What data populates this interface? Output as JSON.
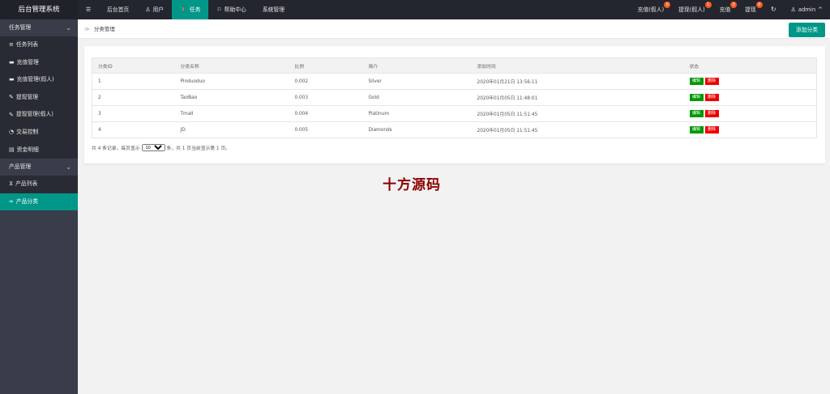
{
  "app_title": "后台管理系统",
  "nav": {
    "toggle_icon": "menu-icon",
    "items": [
      {
        "label": "后台首页",
        "icon": ""
      },
      {
        "label": "用户",
        "icon": "user-icon"
      },
      {
        "label": "任务",
        "icon": "person-walk-icon",
        "active": true
      },
      {
        "label": "帮助中心",
        "icon": "flag-icon"
      },
      {
        "label": "系统管理",
        "icon": ""
      }
    ]
  },
  "right_nav": [
    {
      "label": "充值(假人)",
      "badge": "0"
    },
    {
      "label": "提现(假人)",
      "badge": "1"
    },
    {
      "label": "充值",
      "badge": "0"
    },
    {
      "label": "提现",
      "badge": "0"
    }
  ],
  "user": {
    "name": "admin"
  },
  "sidebar": [
    {
      "type": "group",
      "label": "任务管理"
    },
    {
      "type": "item",
      "label": "任务列表",
      "icon": "list-icon"
    },
    {
      "type": "item",
      "label": "充值管理",
      "icon": "chat-icon"
    },
    {
      "type": "item",
      "label": "充值管理(假人)",
      "icon": "chat-icon"
    },
    {
      "type": "item",
      "label": "提现管理",
      "icon": "wrench-icon"
    },
    {
      "type": "item",
      "label": "提现管理(假人)",
      "icon": "wrench-icon"
    },
    {
      "type": "item",
      "label": "交易控制",
      "icon": "gauge-icon"
    },
    {
      "type": "item",
      "label": "资金明细",
      "icon": "document-icon"
    },
    {
      "type": "group",
      "label": "产品管理"
    },
    {
      "type": "item",
      "label": "产品列表",
      "icon": "cart-icon"
    },
    {
      "type": "item",
      "label": "产品分类",
      "icon": "link-icon",
      "active": true
    }
  ],
  "breadcrumb": {
    "arrow": "≫",
    "label": "分类管理"
  },
  "add_button": "添加分类",
  "table": {
    "headers": [
      "分类ID",
      "分类名称",
      "比例",
      "简介",
      "添加时间",
      "状态"
    ],
    "rows": [
      {
        "id": "1",
        "name": "Pinduoduo",
        "ratio": "0.002",
        "intro": "Silver",
        "time": "2020年01月21日 13:56:11"
      },
      {
        "id": "2",
        "name": "TaoBao",
        "ratio": "0.003",
        "intro": "Gold",
        "time": "2020年01月05日 11:48:01"
      },
      {
        "id": "3",
        "name": "Tmall",
        "ratio": "0.004",
        "intro": "Platinum",
        "time": "2020年01月05日 11:51:45"
      },
      {
        "id": "4",
        "name": "JD",
        "ratio": "0.005",
        "intro": "Diamonds",
        "time": "2020年01月05日 11:51:45"
      }
    ],
    "edit_label": "编辑",
    "delete_label": "删除"
  },
  "pager": {
    "before": "共 4 条记录，每页显示",
    "page_size": "10",
    "after": "条，共 1 页当前显示第 1 页。"
  },
  "watermark": "十方源码",
  "colors": {
    "accent": "#009688",
    "header": "#23262e",
    "sidebar": "#393d49",
    "badge": "#ff5722",
    "edit": "#009900",
    "delete": "#ee0000",
    "watermark": "#8b0000"
  }
}
